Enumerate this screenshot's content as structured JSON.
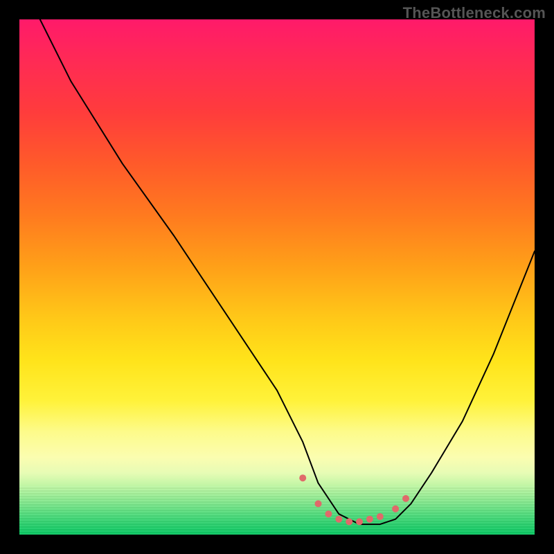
{
  "watermark": "TheBottleneck.com",
  "chart_data": {
    "type": "line",
    "title": "",
    "xlabel": "",
    "ylabel": "",
    "xlim": [
      0,
      100
    ],
    "ylim": [
      0,
      100
    ],
    "grid": false,
    "series": [
      {
        "name": "bottleneck-curve",
        "x": [
          4,
          10,
          20,
          30,
          40,
          50,
          55,
          58,
          62,
          66,
          70,
          73,
          76,
          80,
          86,
          92,
          100
        ],
        "y": [
          100,
          88,
          72,
          58,
          43,
          28,
          18,
          10,
          4,
          2,
          2,
          3,
          6,
          12,
          22,
          35,
          55
        ],
        "stroke": "#000000",
        "stroke_width": 2
      }
    ],
    "markers": [
      {
        "name": "trough-markers",
        "x": [
          55,
          58,
          60,
          62,
          64,
          66,
          68,
          70,
          73,
          75
        ],
        "y": [
          11,
          6,
          4,
          3,
          2.5,
          2.5,
          3,
          3.5,
          5,
          7
        ],
        "color": "#e06a6a",
        "size": 10
      }
    ],
    "colors": {
      "gradient_top": "#ff1a6a",
      "gradient_mid": "#ffe31a",
      "gradient_bottom": "#0ac863",
      "curve": "#000000",
      "marker": "#e06a6a",
      "frame": "#000000"
    }
  }
}
